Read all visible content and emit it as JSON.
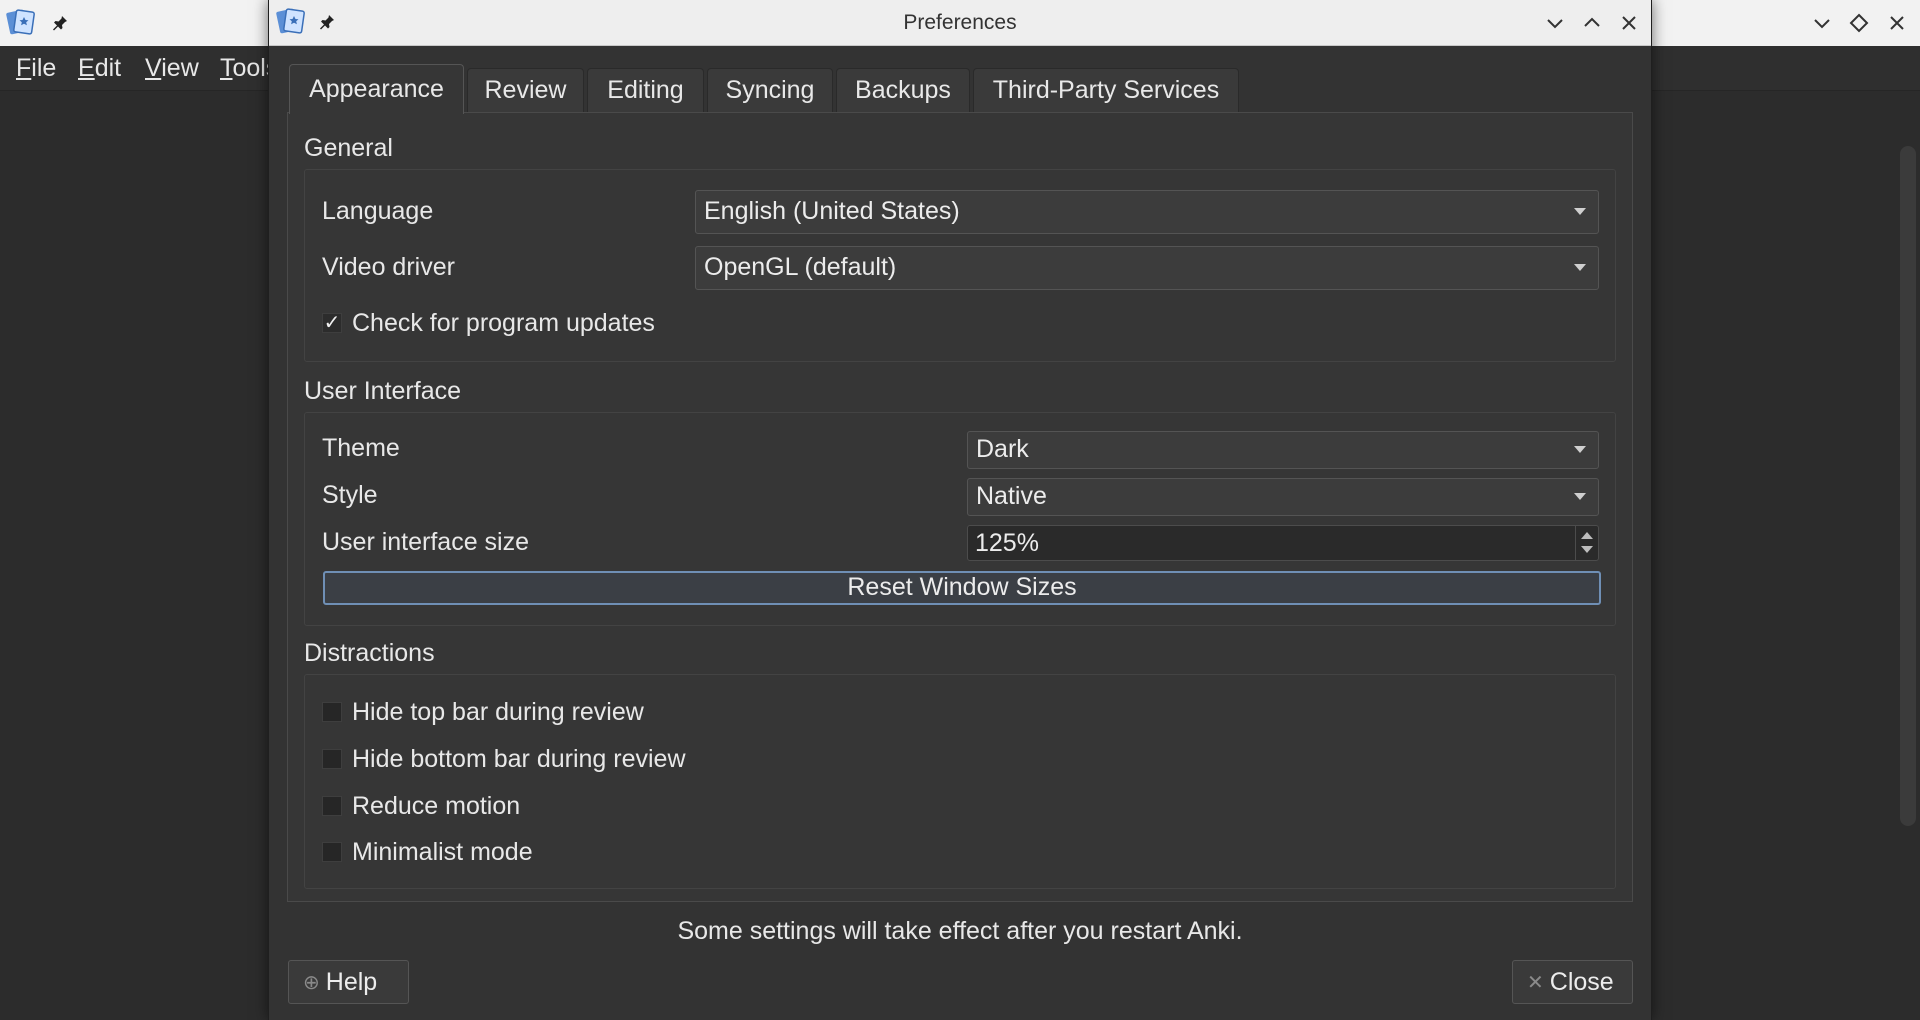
{
  "main_window": {
    "menu": [
      {
        "label": "File",
        "accel": "F",
        "rest": "ile"
      },
      {
        "label": "Edit",
        "accel": "E",
        "rest": "dit"
      },
      {
        "label": "View",
        "accel": "V",
        "rest": "iew"
      },
      {
        "label": "Tools",
        "accel": "T",
        "rest": "ools"
      }
    ]
  },
  "dialog": {
    "title": "Preferences",
    "tabs": [
      "Appearance",
      "Review",
      "Editing",
      "Syncing",
      "Backups",
      "Third-Party Services"
    ],
    "active_tab": "Appearance",
    "general": {
      "title": "General",
      "language_label": "Language",
      "language_value": "English (United States)",
      "video_driver_label": "Video driver",
      "video_driver_value": "OpenGL (default)",
      "check_updates_label": "Check for program updates",
      "check_updates_checked": true
    },
    "user_interface": {
      "title": "User Interface",
      "theme_label": "Theme",
      "theme_value": "Dark",
      "style_label": "Style",
      "style_value": "Native",
      "ui_size_label": "User interface size",
      "ui_size_value": "125%",
      "reset_button": "Reset Window Sizes"
    },
    "distractions": {
      "title": "Distractions",
      "items": [
        {
          "label": "Hide top bar during review",
          "checked": false
        },
        {
          "label": "Hide bottom bar during review",
          "checked": false
        },
        {
          "label": "Reduce motion",
          "checked": false
        },
        {
          "label": "Minimalist mode",
          "checked": false
        }
      ]
    },
    "footer_note": "Some settings will take effect after you restart Anki.",
    "help_button": "Help",
    "close_button": "Close"
  },
  "icons": [
    "anki-logo-icon",
    "pin-icon",
    "minimize-icon",
    "maximize-icon",
    "restore-icon",
    "close-icon",
    "help-icon",
    "close-x-icon"
  ]
}
